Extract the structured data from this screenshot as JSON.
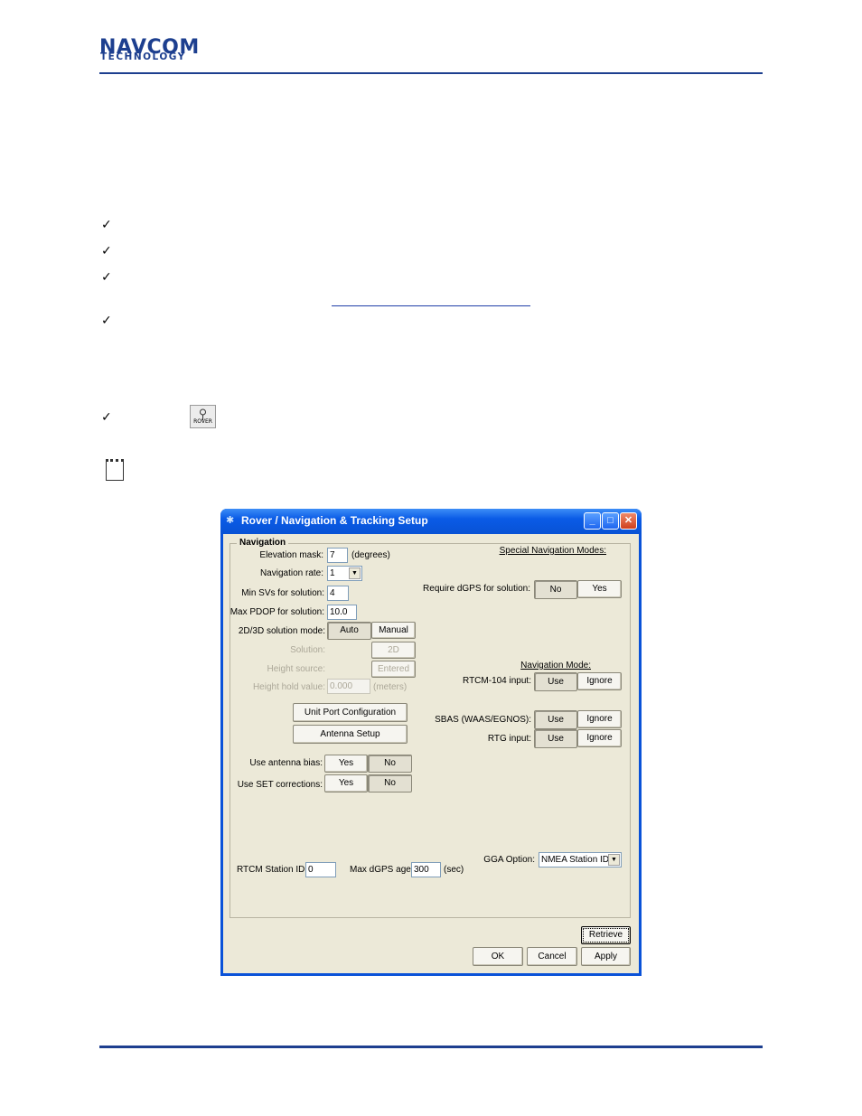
{
  "header": {
    "logo_main": "NAVCOM",
    "logo_sub": "TECHNOLOGY"
  },
  "doc": {
    "checkmark": "✓",
    "rover_icon_label": "ROVER"
  },
  "window": {
    "title": "Rover / Navigation & Tracking Setup",
    "controls": {
      "minimize": "_",
      "maximize": "□",
      "close": "✕"
    },
    "group_title": "Navigation",
    "elevation_mask": {
      "label": "Elevation mask:",
      "value": "7",
      "unit": "(degrees)"
    },
    "navigation_rate": {
      "label": "Navigation rate:",
      "value": "1"
    },
    "min_svs": {
      "label": "Min SVs for solution:",
      "value": "4"
    },
    "max_pdop": {
      "label": "Max PDOP for solution:",
      "value": "10.0"
    },
    "solution_mode": {
      "label": "2D/3D solution mode:",
      "auto": "Auto",
      "manual": "Manual"
    },
    "solution": {
      "label": "Solution:",
      "value": "2D"
    },
    "height_source": {
      "label": "Height source:",
      "value": "Entered"
    },
    "height_hold": {
      "label": "Height hold value:",
      "value": "0.000",
      "unit": "(meters)"
    },
    "unit_port_button": "Unit Port Configuration",
    "antenna_setup_button": "Antenna Setup",
    "antenna_bias": {
      "label": "Use antenna bias:",
      "yes": "Yes",
      "no": "No"
    },
    "set_corrections": {
      "label": "Use SET corrections:",
      "yes": "Yes",
      "no": "No"
    },
    "special_modes_title": "Special Navigation Modes:",
    "require_dgps": {
      "label": "Require dGPS for solution:",
      "no": "No",
      "yes": "Yes"
    },
    "navigation_mode_title": "Navigation Mode:",
    "rtcm104": {
      "label": "RTCM-104 input:",
      "use": "Use",
      "ignore": "Ignore"
    },
    "sbas": {
      "label": "SBAS (WAAS/EGNOS):",
      "use": "Use",
      "ignore": "Ignore"
    },
    "rtg": {
      "label": "RTG input:",
      "use": "Use",
      "ignore": "Ignore"
    },
    "gga_option": {
      "label": "GGA Option:",
      "value": "NMEA Station ID"
    },
    "rtcm_station": {
      "label": "RTCM Station ID:",
      "value": "0"
    },
    "max_dgps_age": {
      "label": "Max dGPS age:",
      "value": "300",
      "unit": "(sec)"
    },
    "retrieve_button": "Retrieve",
    "ok_button": "OK",
    "cancel_button": "Cancel",
    "apply_button": "Apply"
  },
  "colors": {
    "brand": "#1d3f8f",
    "titlebar": "#0a5be6",
    "dialog_bg": "#ece9d8"
  }
}
